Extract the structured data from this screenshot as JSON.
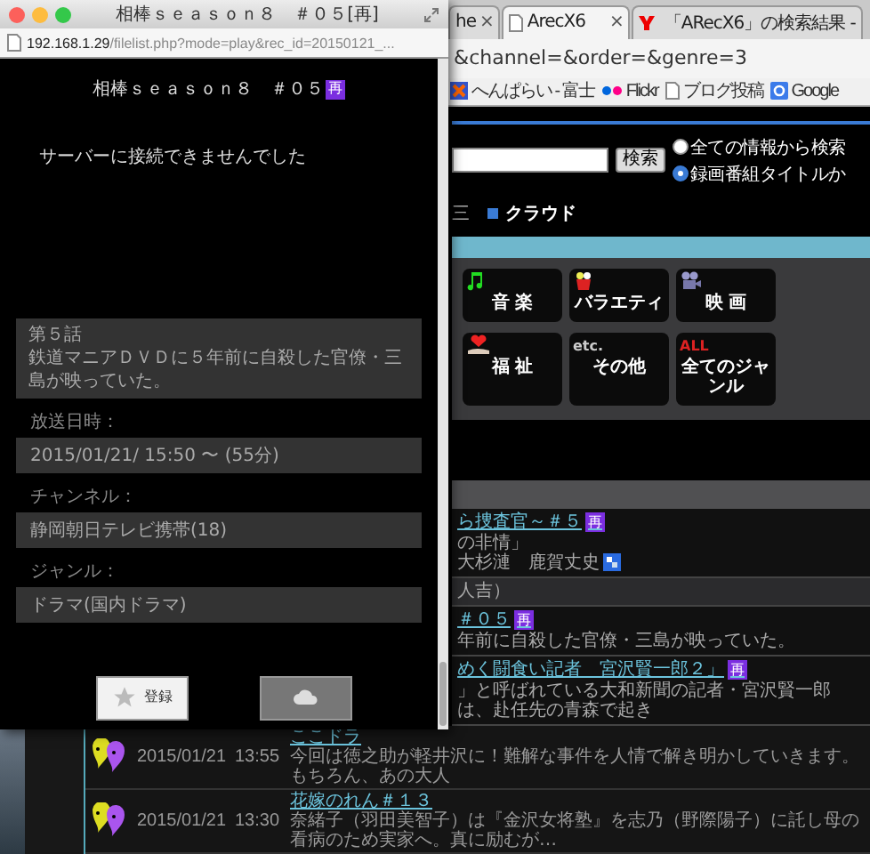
{
  "popup": {
    "title": "相棒ｓｅａｓｏｎ８　＃０５[再]",
    "url": {
      "host": "192.168.1.29",
      "path": "/filelist.php?mode=play&rec_id=20150121_..."
    },
    "heading": "相棒ｓｅａｓｏｎ８　＃０５",
    "heading_badge": "再",
    "message": "サーバーに接続できませんでした",
    "episode": "第５話",
    "synopsis": "鉄道マニアＤＶＤに５年前に自殺した官僚・三島が映っていた。",
    "fields": [
      {
        "label": "放送日時：",
        "value": "2015/01/21/ 15:50  〜 (55分)"
      },
      {
        "label": "チャンネル：",
        "value": "静岡朝日テレビ携帯(18)"
      },
      {
        "label": "ジャンル：",
        "value": "ドラマ(国内ドラマ)"
      }
    ],
    "buttons": [
      {
        "kind": "star",
        "label": "登録"
      },
      {
        "kind": "cloud"
      }
    ]
  },
  "browser": {
    "tabs": [
      {
        "label": "he",
        "close": "×",
        "selected": false
      },
      {
        "label": "ArecX6",
        "close": "×",
        "selected": true
      },
      {
        "label": "「ARecX6」の検索結果 -",
        "selected": false
      }
    ],
    "address": "&channel=&order=&genre=3",
    "bookmarks": [
      {
        "kind": "site",
        "label": "へんぱらい - 富士"
      },
      {
        "kind": "flickr",
        "label": "Flickr"
      },
      {
        "kind": "page",
        "label": "ブログ投稿"
      },
      {
        "kind": "google",
        "label": "Google"
      }
    ],
    "search": {
      "button": "検索",
      "options": [
        {
          "label": "全ての情報から検索",
          "selected": false
        },
        {
          "label": "録画番組タイトルか",
          "selected": true
        }
      ]
    },
    "nav_fragment": "三",
    "nav": "クラウド",
    "genres": [
      {
        "kind": "music",
        "label": "音 楽"
      },
      {
        "kind": "variety",
        "label": "バラエティ"
      },
      {
        "kind": "movie",
        "label": "映 画"
      },
      {
        "kind": "welfare",
        "label": "福 祉"
      },
      {
        "kind": "text",
        "mark": "etc.",
        "label": "その他"
      },
      {
        "kind": "text",
        "mark": "ALL",
        "label": "全てのジャンル"
      }
    ],
    "entries": [
      {
        "kind": "program",
        "title": "ら捜査官～＃５",
        "badge": "再",
        "lines": [
          "の非情」"
        ],
        "cast": "大杉漣　鹿賀丈史"
      },
      {
        "kind": "info",
        "lines": [
          "人吉）"
        ]
      },
      {
        "kind": "program",
        "title": "＃０５",
        "badge": "再",
        "lines": [
          "年前に自殺した官僚・三島が映っていた。"
        ]
      },
      {
        "kind": "program",
        "title": "めく闘食い記者　宮沢賢一郎２」",
        "badge": "再",
        "lines": [
          "」と呼ばれている大和新聞の記者・宮沢賢一郎は、赴任先の青森で起き"
        ]
      }
    ],
    "recordings": [
      {
        "date": "2015/01/21",
        "time": "13:55",
        "title": "ここドラ",
        "desc": "今回は徳之助が軽井沢に！難解な事件を人情で解き明かしていきます。もちろん、あの大人"
      },
      {
        "date": "2015/01/21",
        "time": "13:30",
        "title": "花嫁のれん＃１３",
        "desc": "奈緒子（羽田美智子）は『金沢女将塾』を志乃（野際陽子）に託し母の看病のため実家へ。真に励むが…"
      }
    ]
  }
}
